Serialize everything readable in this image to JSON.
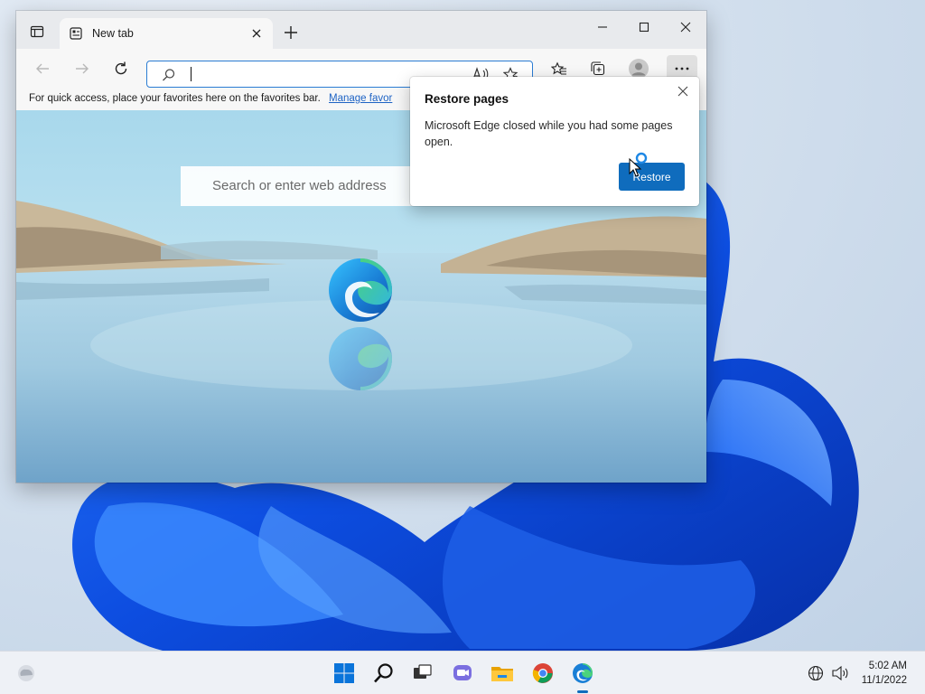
{
  "browser": {
    "tab": {
      "title": "New tab"
    },
    "address_bar": {
      "value": ""
    },
    "favorites_bar": {
      "text": "For quick access, place your favorites here on the favorites bar.",
      "link": "Manage favor"
    },
    "new_tab_page": {
      "search_placeholder": "Search or enter web address"
    }
  },
  "popup": {
    "title": "Restore pages",
    "message": "Microsoft Edge closed while you had some pages open.",
    "button": "Restore"
  },
  "taskbar": {
    "icons": [
      "start-icon",
      "search-icon",
      "task-view-icon",
      "chat-icon",
      "file-explorer-icon",
      "chrome-icon",
      "edge-icon"
    ],
    "time": "5:02 AM",
    "date": "11/1/2022"
  },
  "colors": {
    "accent": "#0f6cbd",
    "link": "#1e63c4",
    "taskbar": "#eef1f6",
    "titlebar": "#e8eaed"
  }
}
